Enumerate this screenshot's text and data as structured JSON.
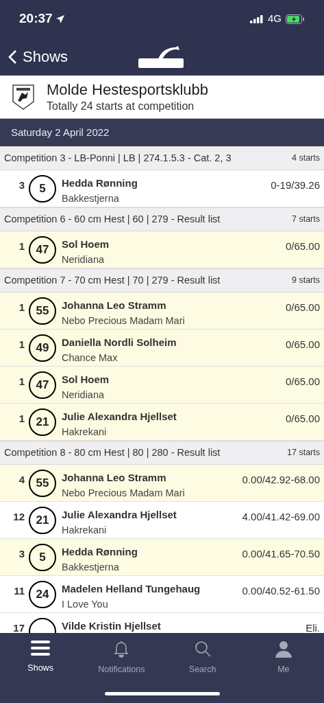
{
  "status_bar": {
    "time": "20:37",
    "network": "4G"
  },
  "nav": {
    "back": "Shows"
  },
  "club": {
    "name": "Molde Hestesportsklubb",
    "subtitle": "Totally 24 starts at competition"
  },
  "date": "Saturday 2 April 2022",
  "competitions": [
    {
      "title": "Competition 3 - LB-Ponni | LB | 274.1.5.3 - Cat. 2, 3",
      "starts": "4 starts",
      "rows": [
        {
          "place": "3",
          "number": "5",
          "rider": "Hedda Rønning",
          "horse": "Bakkestjerna",
          "result": "0-19/39.26",
          "highlighted": false
        }
      ]
    },
    {
      "title": "Competition 6 - 60 cm Hest | 60 | 279 - Result list",
      "starts": "7 starts",
      "rows": [
        {
          "place": "1",
          "number": "47",
          "rider": "Sol Hoem",
          "horse": "Neridiana",
          "result": "0/65.00",
          "highlighted": true
        }
      ]
    },
    {
      "title": "Competition 7 - 70 cm Hest | 70 | 279 - Result list",
      "starts": "9 starts",
      "rows": [
        {
          "place": "1",
          "number": "55",
          "rider": "Johanna Leo Stramm",
          "horse": "Nebo Precious Madam Mari",
          "result": "0/65.00",
          "highlighted": true
        },
        {
          "place": "1",
          "number": "49",
          "rider": "Daniella Nordli Solheim",
          "horse": "Chance Max",
          "result": "0/65.00",
          "highlighted": true
        },
        {
          "place": "1",
          "number": "47",
          "rider": "Sol Hoem",
          "horse": "Neridiana",
          "result": "0/65.00",
          "highlighted": true
        },
        {
          "place": "1",
          "number": "21",
          "rider": "Julie Alexandra Hjellset",
          "horse": "Hakrekani",
          "result": "0/65.00",
          "highlighted": true
        }
      ]
    },
    {
      "title": "Competition 8 - 80 cm Hest | 80 | 280 - Result list",
      "starts": "17 starts",
      "rows": [
        {
          "place": "4",
          "number": "55",
          "rider": "Johanna Leo Stramm",
          "horse": "Nebo Precious Madam Mari",
          "result": "0.00/42.92-68.00",
          "highlighted": true
        },
        {
          "place": "12",
          "number": "21",
          "rider": "Julie Alexandra Hjellset",
          "horse": "Hakrekani",
          "result": "4.00/41.42-69.00",
          "highlighted": false
        },
        {
          "place": "3",
          "number": "5",
          "rider": "Hedda Rønning",
          "horse": "Bakkestjerna",
          "result": "0.00/41.65-70.50",
          "highlighted": true
        },
        {
          "place": "11",
          "number": "24",
          "rider": "Madelen Helland Tungehaug",
          "horse": "I Love You",
          "result": "0.00/40.52-61.50",
          "highlighted": false
        },
        {
          "place": "17",
          "rider": "Vilde Kristin Hjellset",
          "result": "Eli.",
          "highlighted": false
        }
      ]
    }
  ],
  "tabs": [
    {
      "label": "Shows",
      "kind": "menu",
      "selected": true
    },
    {
      "label": "Notifications",
      "kind": "bell",
      "selected": false
    },
    {
      "label": "Search",
      "kind": "search",
      "selected": false
    },
    {
      "label": "Me",
      "kind": "person",
      "selected": false
    }
  ]
}
